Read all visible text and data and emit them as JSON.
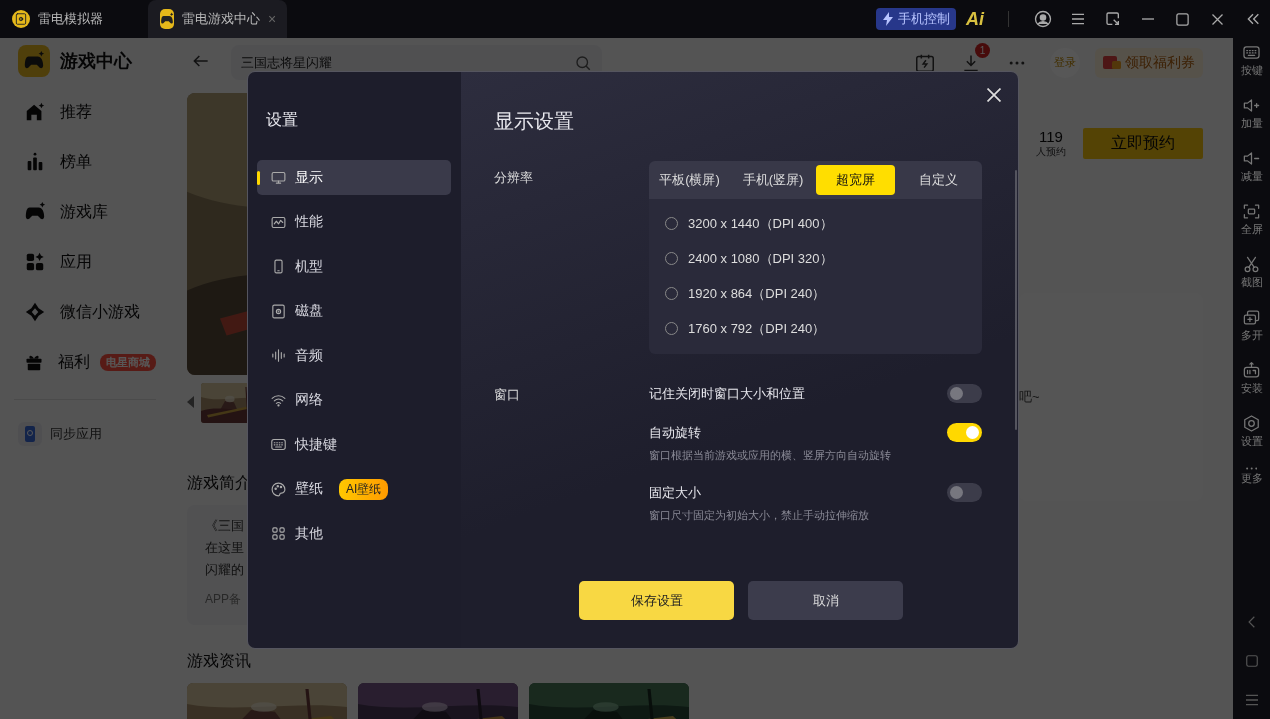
{
  "title_bar": {
    "tabs": [
      {
        "label": "雷电模拟器",
        "selected": false
      },
      {
        "label": "雷电游戏中心",
        "selected": true,
        "close_symbol": "×"
      }
    ],
    "phone_control": "手机控制",
    "ai_logo": "Ai"
  },
  "sidebar": {
    "title": "游戏中心",
    "items": [
      {
        "label": "推荐",
        "selected": false
      },
      {
        "label": "榜单",
        "selected": false
      },
      {
        "label": "游戏库",
        "selected": false
      },
      {
        "label": "应用",
        "selected": false
      },
      {
        "label": "微信小游戏",
        "selected": false
      },
      {
        "label": "福利",
        "selected": false,
        "badge": "电星商城"
      }
    ],
    "sync": "同步应用"
  },
  "header": {
    "search": "三国志将星闪耀",
    "download_badge": "1",
    "login": "登录",
    "coupon": "领取福利券"
  },
  "game": {
    "reserve_count": "119",
    "reserve_label": "人预约",
    "reserve_button": "立即预约",
    "review_hint": "吧~",
    "intro_title": "游戏简介",
    "intro_lines": [
      "《三国",
      "在这里",
      "闪耀的"
    ],
    "filing": "APP备",
    "news_title": "游戏资讯",
    "news": [
      {
        "kind": "picture"
      },
      {
        "kind": "picture"
      },
      {
        "kind": "picture"
      }
    ]
  },
  "right_toolbar": {
    "items": [
      {
        "label": "按键"
      },
      {
        "label": "加量"
      },
      {
        "label": "减量"
      },
      {
        "label": "全屏"
      },
      {
        "label": "截图"
      },
      {
        "label": "多开"
      },
      {
        "label": "安装"
      },
      {
        "label": "设置"
      },
      {
        "label": "更多"
      }
    ]
  },
  "dialog": {
    "title": "设置",
    "menu": [
      {
        "label": "显示",
        "selected": true
      },
      {
        "label": "性能",
        "selected": false
      },
      {
        "label": "机型",
        "selected": false
      },
      {
        "label": "磁盘",
        "selected": false
      },
      {
        "label": "音频",
        "selected": false
      },
      {
        "label": "网络",
        "selected": false
      },
      {
        "label": "快捷键",
        "selected": false
      },
      {
        "label": "壁纸",
        "selected": false,
        "badge": "AI壁纸"
      },
      {
        "label": "其他",
        "selected": false
      }
    ],
    "section_title": "显示设置",
    "resolution": {
      "label": "分辨率",
      "tabs": [
        {
          "label": "平板(横屏)",
          "selected": false
        },
        {
          "label": "手机(竖屏)",
          "selected": false
        },
        {
          "label": "超宽屏",
          "selected": true
        },
        {
          "label": "自定义",
          "selected": false
        }
      ],
      "options": [
        {
          "label": "3200 x 1440（DPI 400）",
          "selected": false
        },
        {
          "label": "2400 x 1080（DPI 320）",
          "selected": false
        },
        {
          "label": "1920 x 864（DPI 240）",
          "selected": false
        },
        {
          "label": "1760 x 792（DPI 240）",
          "selected": false
        }
      ]
    },
    "window": {
      "label": "窗口",
      "settings": [
        {
          "label": "记住关闭时窗口大小和位置",
          "on": false
        },
        {
          "label": "自动旋转",
          "on": true,
          "description": "窗口根据当前游戏或应用的横、竖屏方向自动旋转"
        },
        {
          "label": "固定大小",
          "on": false,
          "description": "窗口尺寸固定为初始大小，禁止手动拉伸缩放"
        }
      ]
    },
    "buttons": [
      {
        "label": "保存设置",
        "kind": "primary"
      },
      {
        "label": "取消",
        "kind": "secondary"
      }
    ]
  }
}
